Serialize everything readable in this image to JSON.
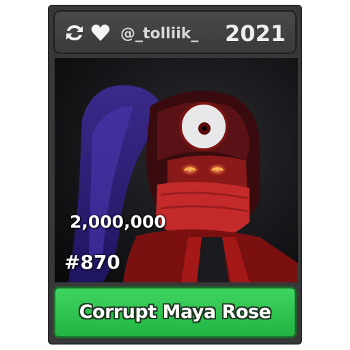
{
  "card": {
    "header": {
      "trade_icon": "trade-arrows-icon",
      "favorite_icon": "heart-icon",
      "creator": "@_tolliik_",
      "year": "2021"
    },
    "artwork": {
      "description_icon": "character-art"
    },
    "value": "2,000,000",
    "serial": "#870",
    "name": "Corrupt Maya Rose",
    "colors": {
      "frame": "#383838",
      "header": "#444444",
      "name_bar": "#2fc44f",
      "name_outline": "#1d3a22"
    }
  }
}
